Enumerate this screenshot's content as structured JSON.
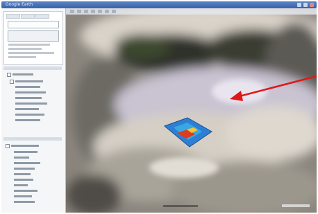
{
  "window": {
    "title": "Google Earth"
  },
  "colors": {
    "titlebar": "#3a62a8",
    "arrow": "#e01818",
    "overlay_blue": "#2d7fd6",
    "overlay_red": "#e03a1f"
  },
  "icons": {
    "sidebar_search": "search-icon",
    "layers_tree": "tree-icon",
    "overlay_marker": "map-overlay-icon",
    "annotation": "arrow-icon"
  }
}
